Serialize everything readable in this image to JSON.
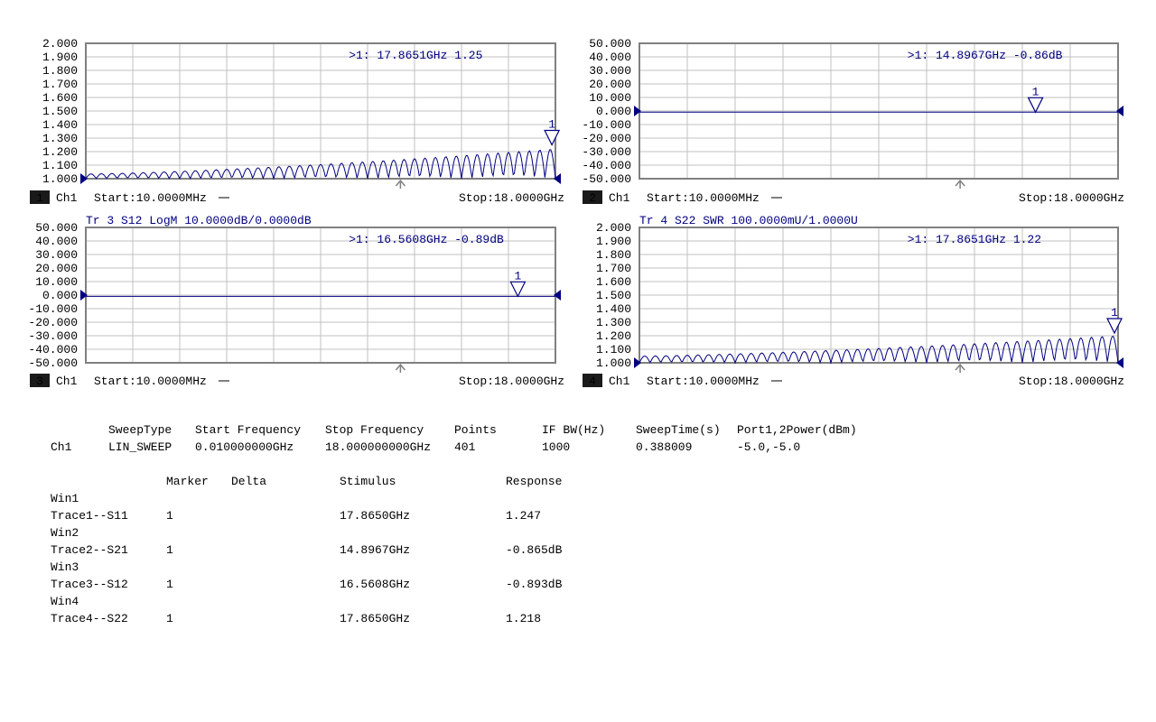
{
  "colors": {
    "trace": "#000080",
    "grid": "#c0c0c0",
    "frame": "#808080",
    "text": "#000000"
  },
  "chart_data": [
    {
      "type": "line",
      "window": "1",
      "channel": "Ch1",
      "title": "",
      "start_label": "Start:10.0000MHz",
      "stop_label": "Stop:18.0000GHz",
      "yticks": [
        "2.000",
        "1.900",
        "1.800",
        "1.700",
        "1.600",
        "1.500",
        "1.400",
        "1.300",
        "1.200",
        "1.100",
        "1.000"
      ],
      "ylim": [
        1.0,
        2.0
      ],
      "xlim": [
        0.01,
        18.0
      ],
      "series": [
        {
          "name": "S11",
          "shape": "swr",
          "base": 1.0,
          "amp_start": 0.035,
          "amp_end": 0.22,
          "cycles": 45
        }
      ],
      "marker": {
        "label": "1",
        "x_ghz": 17.8651,
        "value": 1.25,
        "readout": ">1:   17.8651GHz 1.25"
      }
    },
    {
      "type": "line",
      "window": "2",
      "channel": "Ch1",
      "title": "",
      "start_label": "Start:10.0000MHz",
      "stop_label": "Stop:18.0000GHz",
      "yticks": [
        "50.000",
        "40.000",
        "30.000",
        "20.000",
        "10.000",
        "0.000",
        "-10.000",
        "-20.000",
        "-30.000",
        "-40.000",
        "-50.000"
      ],
      "ylim": [
        -50,
        50
      ],
      "xlim": [
        0.01,
        18.0
      ],
      "series": [
        {
          "name": "S21",
          "shape": "flat",
          "value": -0.86
        }
      ],
      "marker": {
        "label": "1",
        "x_ghz": 14.8967,
        "value": -0.86,
        "readout": ">1:   14.8967GHz -0.86dB"
      }
    },
    {
      "type": "line",
      "window": "3",
      "channel": "Ch1",
      "title": "Tr 3  S12 LogM 10.0000dB/0.0000dB",
      "start_label": "Start:10.0000MHz",
      "stop_label": "Stop:18.0000GHz",
      "yticks": [
        "50.000",
        "40.000",
        "30.000",
        "20.000",
        "10.000",
        "0.000",
        "-10.000",
        "-20.000",
        "-30.000",
        "-40.000",
        "-50.000"
      ],
      "ylim": [
        -50,
        50
      ],
      "xlim": [
        0.01,
        18.0
      ],
      "series": [
        {
          "name": "S12",
          "shape": "flat",
          "value": -0.89
        }
      ],
      "marker": {
        "label": "1",
        "x_ghz": 16.5608,
        "value": -0.89,
        "readout": ">1:   16.5608GHz -0.89dB"
      }
    },
    {
      "type": "line",
      "window": "4",
      "channel": "Ch1",
      "title": "Tr 4  S22 SWR 100.0000mU/1.0000U",
      "start_label": "Start:10.0000MHz",
      "stop_label": "Stop:18.0000GHz",
      "yticks": [
        "2.000",
        "1.900",
        "1.800",
        "1.700",
        "1.600",
        "1.500",
        "1.400",
        "1.300",
        "1.200",
        "1.100",
        "1.000"
      ],
      "ylim": [
        1.0,
        2.0
      ],
      "xlim": [
        0.01,
        18.0
      ],
      "series": [
        {
          "name": "S22",
          "shape": "swr",
          "base": 1.0,
          "amp_start": 0.05,
          "amp_end": 0.2,
          "cycles": 45
        }
      ],
      "marker": {
        "label": "1",
        "x_ghz": 17.8651,
        "value": 1.22,
        "readout": ">1:   17.8651GHz 1.22"
      }
    }
  ],
  "sweep": {
    "headers": [
      "SweepType",
      "Start Frequency",
      "Stop Frequency",
      "Points",
      "IF BW(Hz)",
      "SweepTime(s)",
      "Port1,2Power(dBm)"
    ],
    "channel": "Ch1",
    "values": [
      "LIN_SWEEP",
      "0.010000000GHz",
      "18.000000000GHz",
      "401",
      "1000",
      "0.388009",
      "-5.0,-5.0"
    ]
  },
  "markers_table": {
    "headers": [
      "Marker",
      "Delta",
      "Stimulus",
      "Response"
    ],
    "windows": [
      {
        "win": "Win1",
        "trace": "Trace1--S11",
        "marker": "1",
        "stimulus": "17.8650GHz",
        "response": "1.247"
      },
      {
        "win": "Win2",
        "trace": "Trace2--S21",
        "marker": "1",
        "stimulus": "14.8967GHz",
        "response": "-0.865dB"
      },
      {
        "win": "Win3",
        "trace": "Trace3--S12",
        "marker": "1",
        "stimulus": "16.5608GHz",
        "response": "-0.893dB"
      },
      {
        "win": "Win4",
        "trace": "Trace4--S22",
        "marker": "1",
        "stimulus": "17.8650GHz",
        "response": "1.218"
      }
    ]
  }
}
